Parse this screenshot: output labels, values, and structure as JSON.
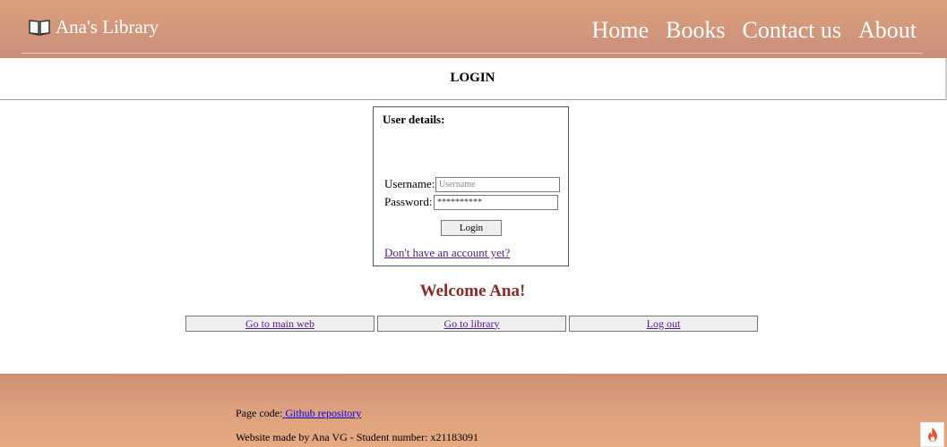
{
  "header": {
    "site_title": "Ana's Library",
    "nav": [
      "Home",
      "Books",
      "Contact us",
      "About"
    ]
  },
  "page_title": "LOGIN",
  "login_form": {
    "legend": "User details:",
    "username_label": "Username:",
    "username_placeholder": "Username",
    "password_label": "Password:",
    "password_value": "**********",
    "login_button": "Login",
    "signup_link": "Don't have an account yet?"
  },
  "welcome": "Welcome Ana!",
  "actions": [
    "Go to main web",
    "Go to library",
    "Log out"
  ],
  "footer": {
    "code_label": "Page code:",
    "code_link": " Github repository",
    "credit": "Website made by Ana VG - Student number: x21183091"
  },
  "colors": {
    "header": "#d59a7c",
    "welcome": "#8b2a2a",
    "footer": "#dca17e"
  }
}
